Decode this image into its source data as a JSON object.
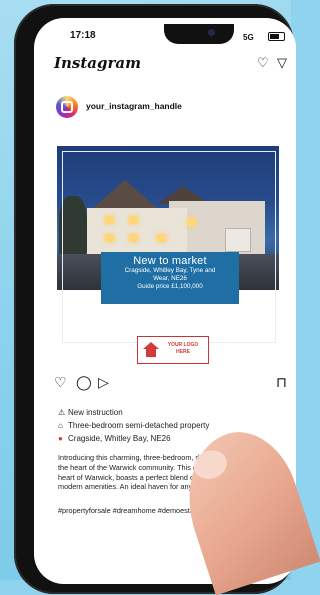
{
  "status_bar": {
    "time": "17:18",
    "network": "5G"
  },
  "app": {
    "title": "Instagram"
  },
  "post": {
    "username": "your_instagram_handle",
    "banner": {
      "title": "New to market",
      "address_line1": "Cragside, Whitley Bay, Tyne and",
      "address_line2": "Wear, NE26",
      "price": "Guide price £1,100,000"
    },
    "logo_text": "YOUR LOGO HERE",
    "caption": {
      "line1": "New instruction",
      "line2": "Three-bedroom semi-detached property",
      "line3": "Cragside, Whitley Bay, NE26",
      "paragraph": "Introducing this charming, three-bedroom, detached home nestled in the heart of the Warwick community. This delightful property in the heart of Warwick, boasts a perfect blend of character, comfort and modern amenities. An ideal haven for any family.",
      "hashtags": "#propertyforsale #dreamhome #demoestate"
    }
  },
  "icons": {
    "heart": "heart-icon",
    "send": "send-icon",
    "comment": "comment-icon",
    "bookmark": "bookmark-icon",
    "announcement": "megaphone-icon",
    "house": "house-icon",
    "pin": "pin-icon"
  },
  "colors": {
    "banner": "#1f6fa5",
    "logo": "#d43a3a",
    "background": "#8fd3ee"
  }
}
